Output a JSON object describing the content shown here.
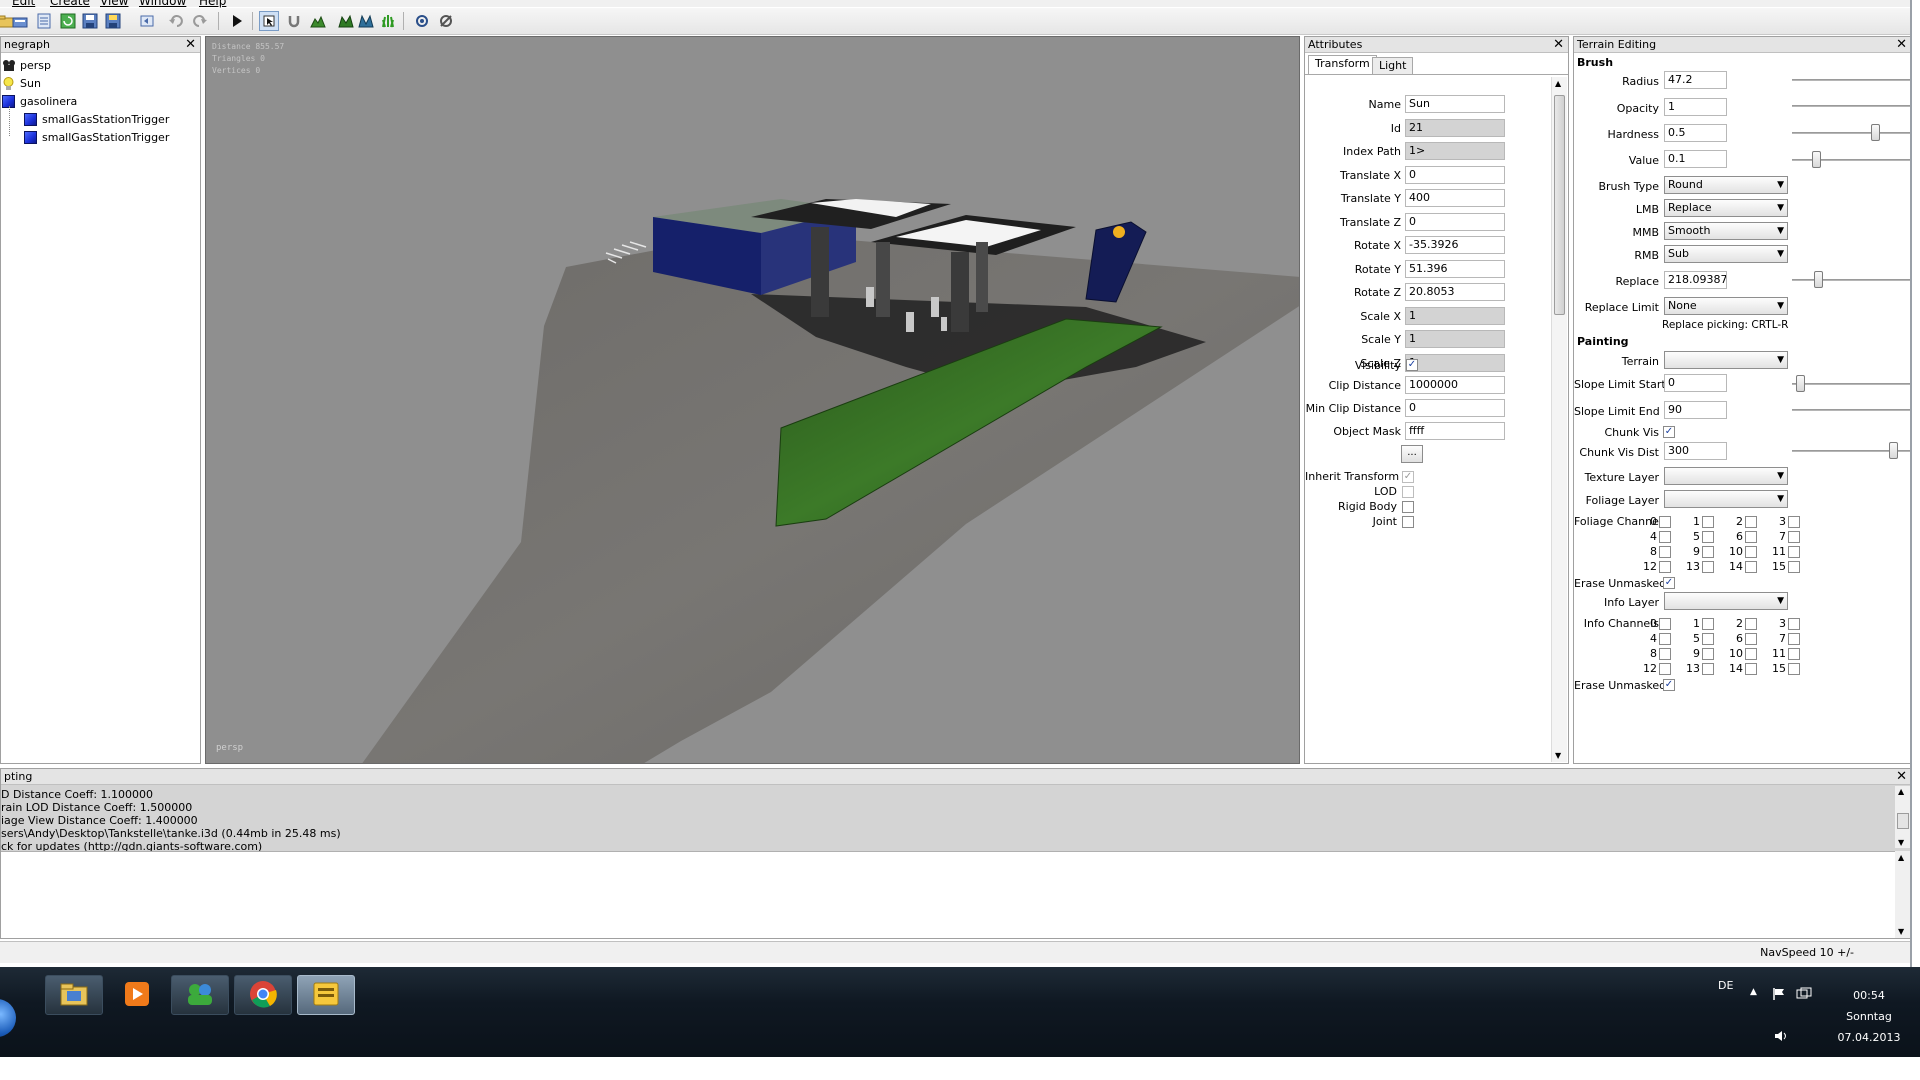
{
  "menu": [
    "Edit",
    "Create",
    "View",
    "Window",
    "Help"
  ],
  "toolbar_icons": [
    "open-icon",
    "list-icon",
    "refresh-icon",
    "save-icon",
    "save-all-icon",
    "undo-history-icon",
    "undo-icon",
    "redo-icon",
    "play-icon",
    "select-icon",
    "magnet-icon",
    "terrain-sculpt-icon",
    "terrain-paint-icon",
    "foliage-icon",
    "grass-icon",
    "settings-icon",
    "tools-icon"
  ],
  "scenegraph": {
    "title": "negraph",
    "items": [
      {
        "label": "persp",
        "icon": "camera-icon"
      },
      {
        "label": "Sun",
        "icon": "lightbulb-icon"
      },
      {
        "label": "gasolinera",
        "icon": "cube-icon"
      },
      {
        "label": "smallGasStationTrigger",
        "icon": "cube-icon"
      },
      {
        "label": "smallGasStationTrigger",
        "icon": "cube-icon"
      }
    ]
  },
  "viewport": {
    "stats": [
      "Distance 855.57",
      "Triangles 0",
      "Vertices 0"
    ],
    "camera_label": "persp"
  },
  "attributes": {
    "title": "Attributes",
    "tabs": [
      "Transform",
      "Light"
    ],
    "fields": [
      {
        "label": "Name",
        "value": "Sun",
        "readonly": false
      },
      {
        "label": "Id",
        "value": "21",
        "readonly": true
      },
      {
        "label": "Index Path",
        "value": "1>",
        "readonly": true
      },
      {
        "label": "Translate X",
        "value": "0",
        "readonly": false
      },
      {
        "label": "Translate Y",
        "value": "400",
        "readonly": false
      },
      {
        "label": "Translate Z",
        "value": "0",
        "readonly": false
      },
      {
        "label": "Rotate X",
        "value": "-35.3926",
        "readonly": false
      },
      {
        "label": "Rotate Y",
        "value": "51.396",
        "readonly": false
      },
      {
        "label": "Rotate Z",
        "value": "20.8053",
        "readonly": false
      },
      {
        "label": "Scale X",
        "value": "1",
        "readonly": true
      },
      {
        "label": "Scale Y",
        "value": "1",
        "readonly": true
      },
      {
        "label": "Scale Z",
        "value": "1",
        "readonly": true
      }
    ],
    "visibility_label": "Visibility",
    "clip_fields": [
      {
        "label": "Clip Distance",
        "value": "1000000"
      },
      {
        "label": "Min Clip Distance",
        "value": "0"
      },
      {
        "label": "Object Mask",
        "value": "ffff"
      }
    ],
    "ellipsis_button": "...",
    "checkboxes": [
      {
        "label": "Inherit Transform",
        "checked": true,
        "disabled": true
      },
      {
        "label": "LOD",
        "checked": false,
        "disabled": true
      },
      {
        "label": "Rigid Body",
        "checked": false,
        "disabled": false
      },
      {
        "label": "Joint",
        "checked": false,
        "disabled": false
      }
    ]
  },
  "terrain": {
    "title": "Terrain Editing",
    "brush_section": "Brush",
    "radius": {
      "label": "Radius",
      "value": "47.2"
    },
    "opacity": {
      "label": "Opacity",
      "value": "1"
    },
    "hardness": {
      "label": "Hardness",
      "value": "0.5",
      "slider": 0.9
    },
    "value": {
      "label": "Value",
      "value": "0.1",
      "slider": 0.2
    },
    "brush_type": {
      "label": "Brush Type",
      "value": "Round"
    },
    "lmb": {
      "label": "LMB",
      "value": "Replace"
    },
    "mmb": {
      "label": "MMB",
      "value": "Smooth"
    },
    "rmb": {
      "label": "RMB",
      "value": "Sub"
    },
    "replace": {
      "label": "Replace",
      "value": "218.09387",
      "slider": 0.2
    },
    "replace_limit": {
      "label": "Replace Limit",
      "value": "None"
    },
    "replace_picking": "Replace picking: CRTL-R",
    "painting_section": "Painting",
    "terrain_combo": {
      "label": "Terrain",
      "value": ""
    },
    "slope_start": {
      "label": "Slope Limit Start",
      "value": "0",
      "slider": 0.0
    },
    "slope_end": {
      "label": "Slope Limit End",
      "value": "90"
    },
    "chunk_vis": {
      "label": "Chunk Vis",
      "checked": true
    },
    "chunk_vis_dist": {
      "label": "Chunk Vis Dist",
      "value": "300",
      "slider": 0.85
    },
    "texture_layer": {
      "label": "Texture Layer",
      "value": ""
    },
    "foliage_layer": {
      "label": "Foliage Layer",
      "value": ""
    },
    "foliage_channels_label": "Foliage Channels",
    "channels": [
      "0",
      "1",
      "2",
      "3",
      "4",
      "5",
      "6",
      "7",
      "8",
      "9",
      "10",
      "11",
      "12",
      "13",
      "14",
      "15"
    ],
    "erase_unmasked_1": {
      "label": "Erase Unmasked",
      "checked": true
    },
    "info_layer": {
      "label": "Info Layer",
      "value": ""
    },
    "info_channels_label": "Info Channels",
    "erase_unmasked_2": {
      "label": "Erase Unmasked",
      "checked": true
    }
  },
  "scripting": {
    "title": "pting",
    "lines": [
      "D Distance Coeff: 1.100000",
      "rain LOD Distance Coeff: 1.500000",
      "iage View Distance Coeff: 1.400000",
      "sers\\Andy\\Desktop\\Tankstelle\\tanke.i3d (0.44mb in 25.48 ms)",
      "ck for updates (http://gdn.giants-software.com)"
    ]
  },
  "statusbar": {
    "nav_speed": "NavSpeed 10 +/-"
  },
  "taskbar": {
    "apps": [
      "file-explorer-icon",
      "media-player-icon",
      "messenger-icon",
      "chrome-icon",
      "giants-editor-icon"
    ],
    "language": "DE",
    "time": "00:54",
    "day": "Sonntag",
    "date": "07.04.2013"
  }
}
